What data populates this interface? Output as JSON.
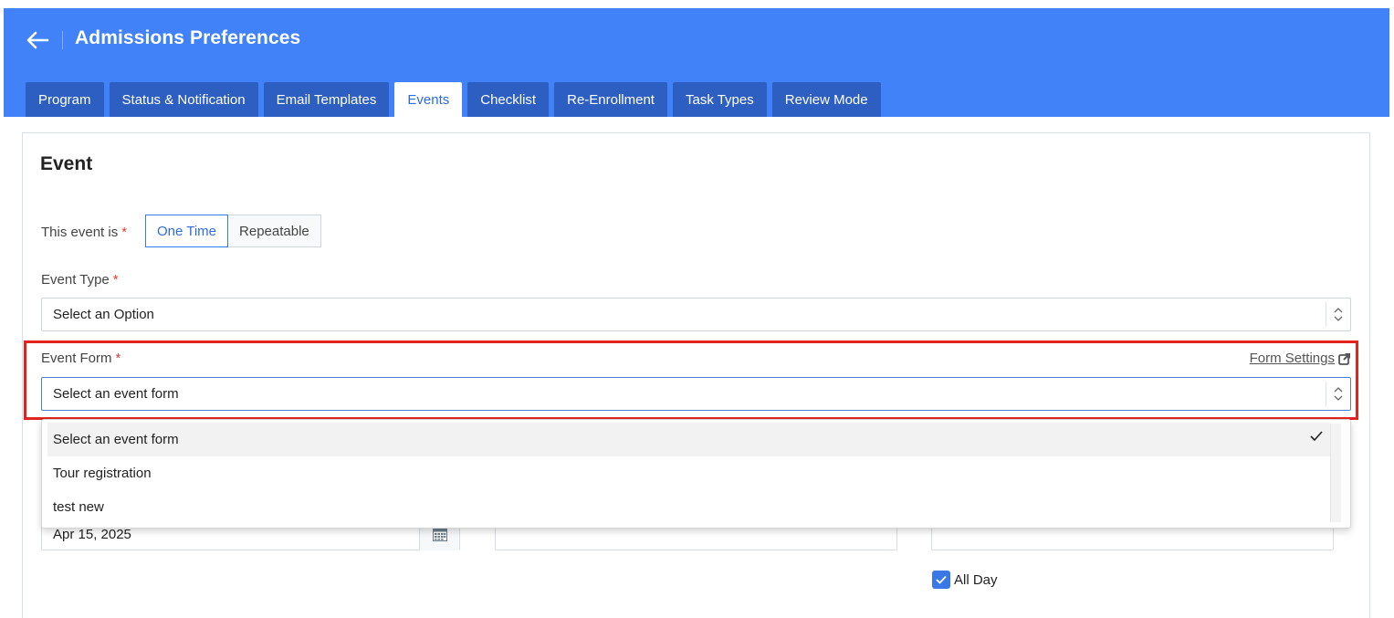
{
  "header": {
    "title": "Admissions Preferences",
    "bg_color": "#4182f8"
  },
  "tabs": [
    {
      "label": "Program",
      "active": false
    },
    {
      "label": "Status & Notification",
      "active": false
    },
    {
      "label": "Email Templates",
      "active": false
    },
    {
      "label": "Events",
      "active": true
    },
    {
      "label": "Checklist",
      "active": false
    },
    {
      "label": "Re-Enrollment",
      "active": false
    },
    {
      "label": "Task Types",
      "active": false
    },
    {
      "label": "Review Mode",
      "active": false
    }
  ],
  "card": {
    "title": "Event",
    "event_is": {
      "label": "This event is",
      "required_mark": "*",
      "options": [
        "One Time",
        "Repeatable"
      ],
      "selected": "One Time"
    },
    "event_type": {
      "label": "Event Type",
      "required_mark": "*",
      "value": "Select an Option"
    },
    "event_form": {
      "label": "Event Form",
      "required_mark": "*",
      "value": "Select an event form",
      "settings_link": "Form Settings",
      "highlight_color": "#e3231d"
    },
    "dropdown": {
      "options": [
        {
          "label": "Select an event form",
          "selected": true
        },
        {
          "label": "Tour registration",
          "selected": false
        },
        {
          "label": "test new",
          "selected": false
        }
      ]
    },
    "date_input": {
      "value": "Apr 15, 2025"
    },
    "all_day": {
      "label": "All Day",
      "checked": true
    }
  }
}
